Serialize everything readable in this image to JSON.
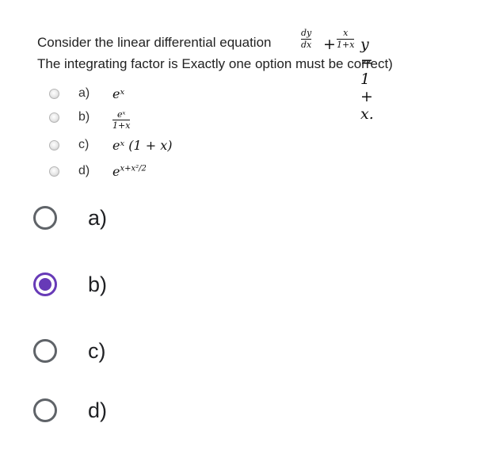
{
  "question": {
    "line1": "Consider the linear differential equation",
    "line2": "The integrating factor is Exactly one option must be correct)",
    "equation": {
      "dy": "dy",
      "dx": "dx",
      "plus": "+",
      "x": "x",
      "one_plus_x": "1+x",
      "rhs": "y = 1 + x."
    },
    "options": [
      {
        "label": "a)",
        "math": "eˣ"
      },
      {
        "label": "b)",
        "num": "eˣ",
        "den": "1+x"
      },
      {
        "label": "c)",
        "math": "eˣ (1 + x)"
      },
      {
        "label": "d)",
        "math": "e",
        "exp": "x+x²/2"
      }
    ]
  },
  "choices": [
    {
      "label": "a)",
      "selected": false
    },
    {
      "label": "b)",
      "selected": true
    },
    {
      "label": "c)",
      "selected": false
    },
    {
      "label": "d)",
      "selected": false
    }
  ],
  "colors": {
    "accent": "#673ab7",
    "radio_border": "#5f6368"
  }
}
